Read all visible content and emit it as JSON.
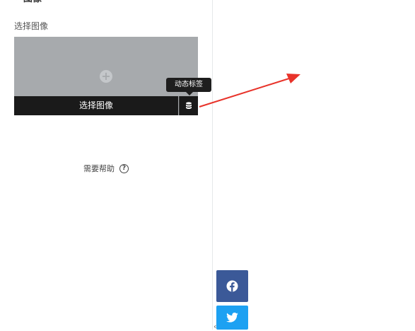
{
  "panel": {
    "section_title": "图像",
    "field_label": "选择图像",
    "choose_image_label": "选择图像",
    "dynamic_tags_tooltip": "动态标签",
    "help_text": "需要帮助",
    "help_icon_glyph": "?"
  },
  "share_buttons": [
    {
      "name": "facebook-icon",
      "color": "#3b5998"
    },
    {
      "name": "twitter-icon",
      "color": "#1da1f2"
    }
  ],
  "annotation_arrow": {
    "color": "#e8332a"
  },
  "collapse_glyph": "‹"
}
